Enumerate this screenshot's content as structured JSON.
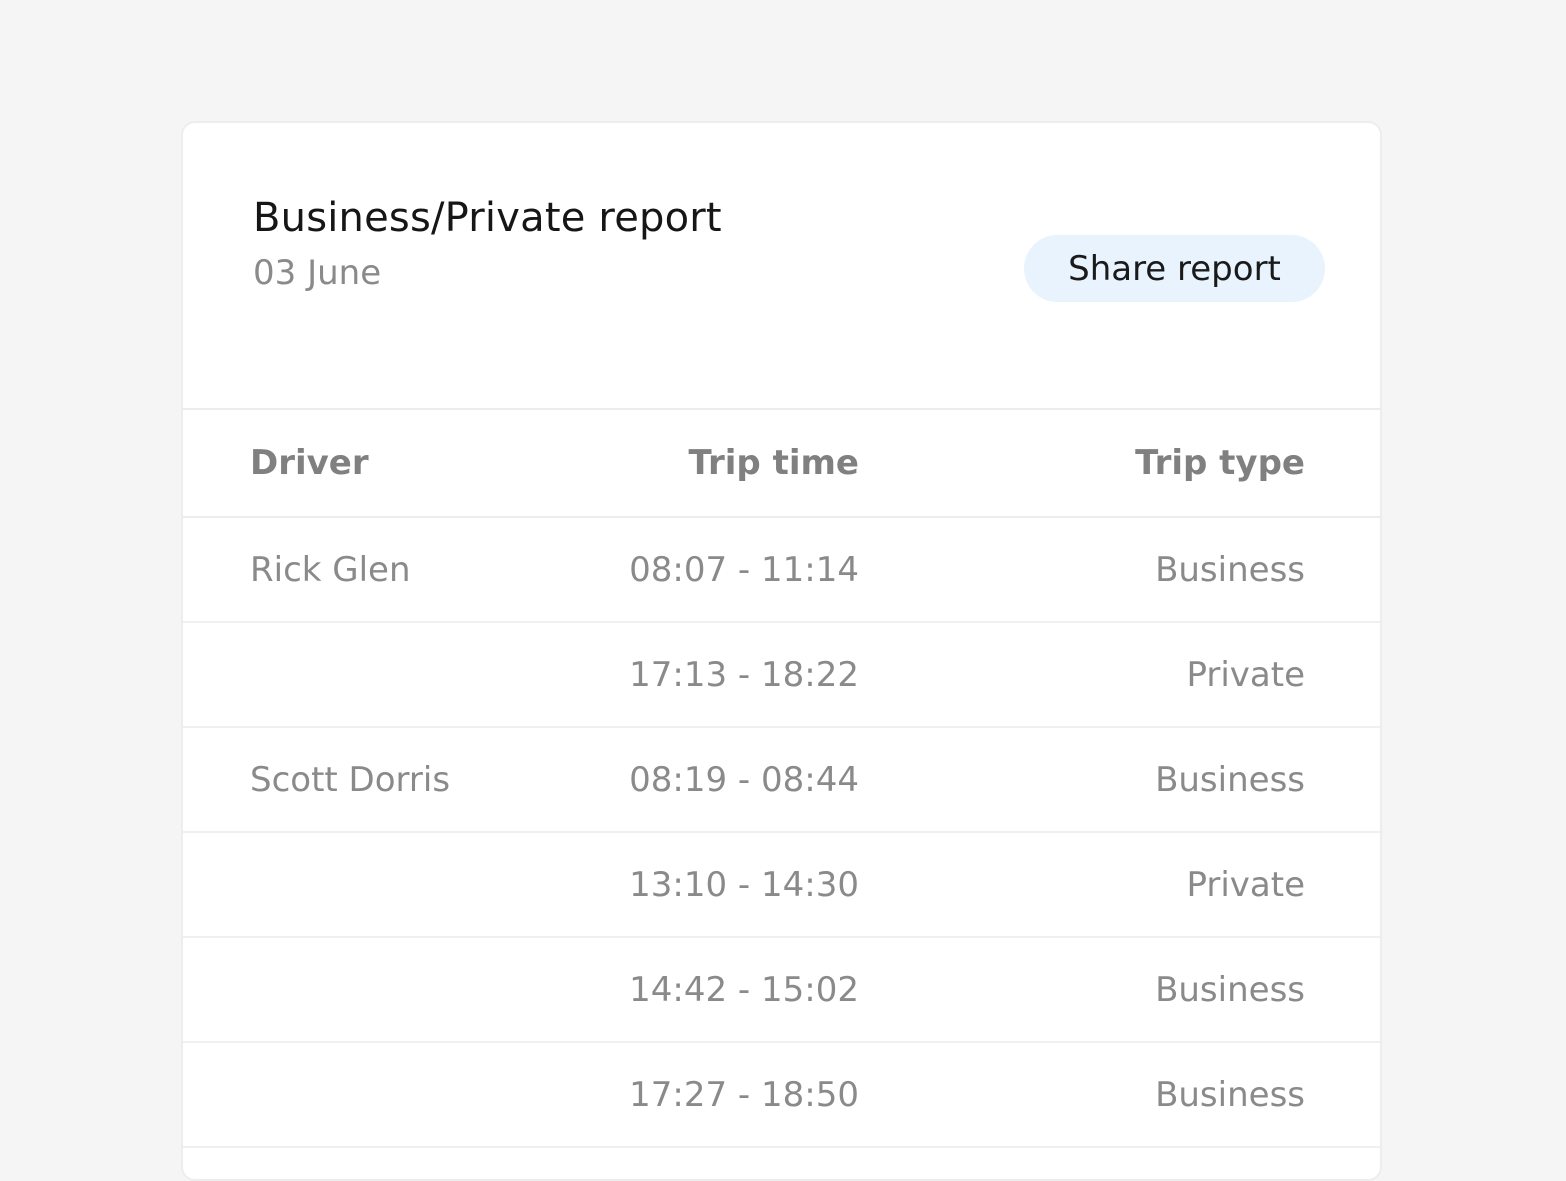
{
  "report": {
    "title": "Business/Private report",
    "date": "03 June",
    "share_label": "Share report"
  },
  "table": {
    "headers": {
      "driver": "Driver",
      "trip_time": "Trip time",
      "trip_type": "Trip type"
    },
    "rows": [
      {
        "driver": "Rick Glen",
        "trip_time": "08:07 - 11:14",
        "trip_type": "Business"
      },
      {
        "driver": "",
        "trip_time": "17:13 - 18:22",
        "trip_type": "Private"
      },
      {
        "driver": "Scott Dorris",
        "trip_time": "08:19 - 08:44",
        "trip_type": "Business"
      },
      {
        "driver": "",
        "trip_time": "13:10 - 14:30",
        "trip_type": "Private"
      },
      {
        "driver": "",
        "trip_time": "14:42 - 15:02",
        "trip_type": "Business"
      },
      {
        "driver": "",
        "trip_time": "17:27 - 18:50",
        "trip_type": "Business"
      }
    ]
  },
  "colors": {
    "page_background": "#f5f5f5",
    "card_background": "#ffffff",
    "button_background": "#e8f3fe",
    "title_text": "#161616",
    "muted_text": "#8a8a8a"
  }
}
